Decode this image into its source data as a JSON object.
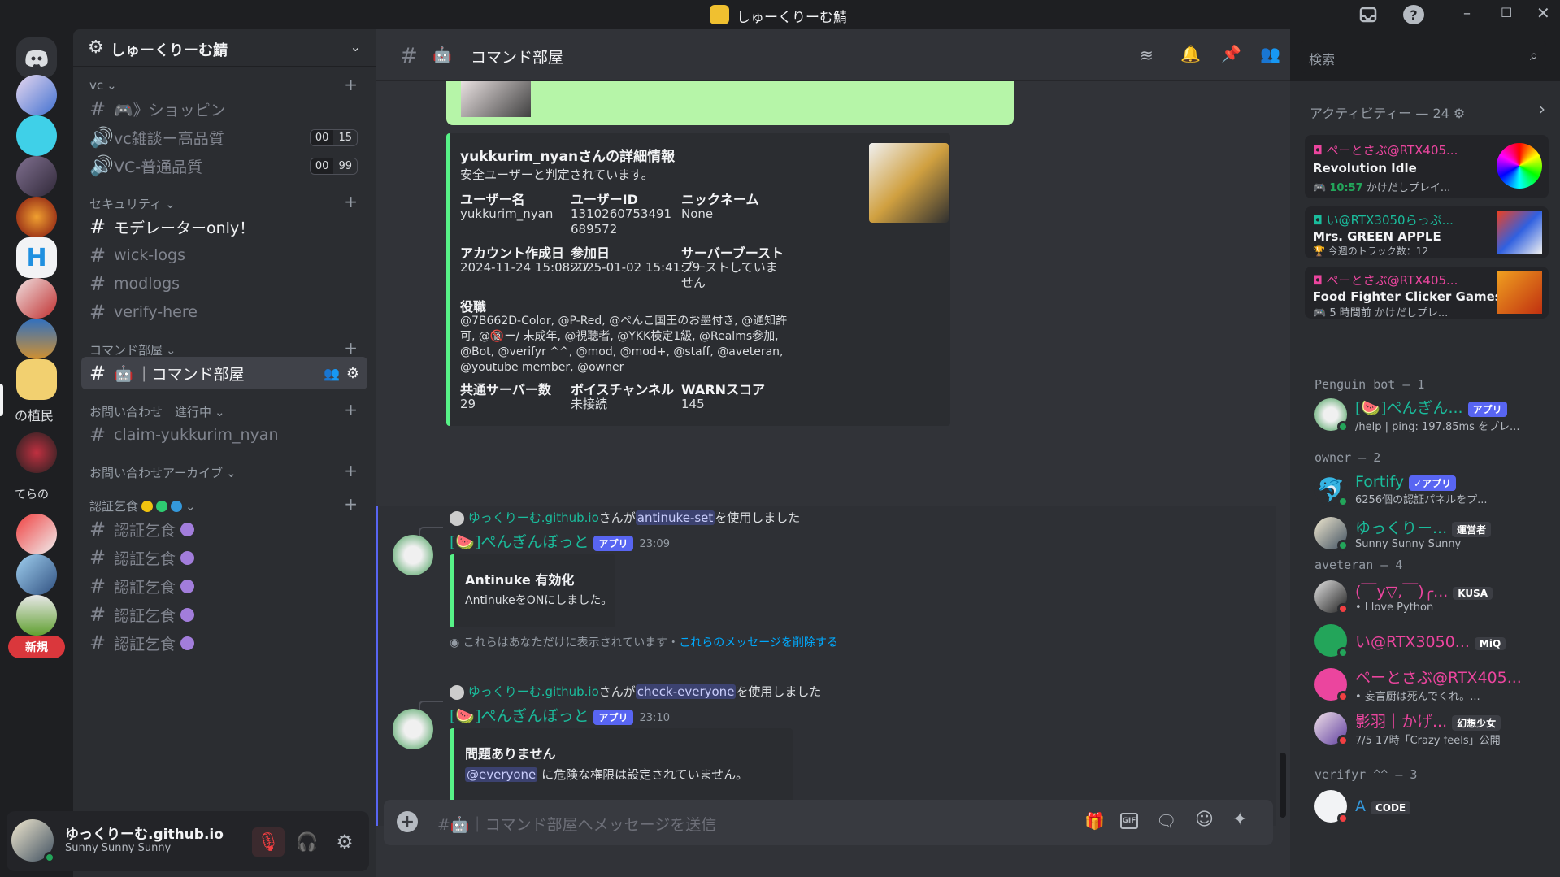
{
  "window": {
    "title": "しゅーくりーむ鯖"
  },
  "guilds": {
    "new_badge": "新規",
    "partial_labels": [
      "の植民",
      "てらの"
    ]
  },
  "server": {
    "name": "しゅーくりーむ鯖"
  },
  "categories": [
    {
      "label": "vc"
    },
    {
      "label": "セキュリティ"
    },
    {
      "label": "コマンド部屋"
    },
    {
      "label": "お問い合わせ　進行中"
    },
    {
      "label": "お問い合わせアーカイブ"
    },
    {
      "label": "認証乞食"
    }
  ],
  "channels": {
    "shopping": "🎮》ショッピン",
    "vc_high": "vc雑談ー高品質",
    "vc_high_counts": [
      "00",
      "15"
    ],
    "vc_normal": "VC-普通品質",
    "vc_normal_counts": [
      "00",
      "99"
    ],
    "moderator": "モデレーターonly！",
    "wick": "wick-logs",
    "modlogs": "modlogs",
    "verify": "verify-here",
    "command": "｜コマンド部屋",
    "claim": "claim-yukkurim_nyan",
    "auth": [
      "認証乞食",
      "認証乞食",
      "認証乞食",
      "認証乞食",
      "認証乞食"
    ]
  },
  "user": {
    "name": "ゆっくりーむ.github.io",
    "status": "Sunny Sunny Sunny"
  },
  "header": {
    "channel": "｜コマンド部屋",
    "search_placeholder": "検索"
  },
  "embed1": {
    "title": "yukkurim_nyanさんの詳細情報",
    "desc": "安全ユーザーと判定されています。",
    "f1_label": "ユーザー名",
    "f1_value": "yukkurim_nyan",
    "f2_label": "ユーザーID",
    "f2_value": "1310260753491689572",
    "f3_label": "ニックネーム",
    "f3_value": "None",
    "f4_label": "アカウント作成日",
    "f4_value": "2024-11-24 15:08:27",
    "f5_label": "参加日",
    "f5_value": "2025-01-02 15:41:29",
    "f6_label": "サーバーブースト",
    "f6_value": "ブーストしていません",
    "roles_label": "役職",
    "roles_value": "@7B662D-Color, @P-Red, @ぺんこ国王のお墨付き, @通知許可, @🔞ー/ 未成年, @視聴者, @YKK検定1級, @Realms参加, @Bot, @verifyr ^^, @mod, @mod+, @staff, @aveteran, @youtube member, @owner",
    "f7_label": "共通サーバー数",
    "f7_value": "29",
    "f8_label": "ボイスチャンネル",
    "f8_value": "未接続",
    "f9_label": "WARNスコア",
    "f9_value": "145"
  },
  "msg1": {
    "reply_user": "ゆっくりーむ.github.io",
    "reply_mid": "さんが",
    "reply_cmd": "antinuke-set",
    "reply_end": "を使用しました",
    "author": "[🍉]ぺんぎんぼっと",
    "app": "アプリ",
    "time": "23:09",
    "embed_title": "Antinuke 有効化",
    "embed_desc": "AntinukeをONにしました。",
    "ephemeral": "これらはあなただけに表示されています・",
    "dismiss": "これらのメッセージを削除する"
  },
  "msg2": {
    "reply_user": "ゆっくりーむ.github.io",
    "reply_mid": "さんが",
    "reply_cmd": "check-everyone",
    "reply_end": "を使用しました",
    "author": "[🍉]ぺんぎんぼっと",
    "app": "アプリ",
    "time": "23:10",
    "embed_title": "問題ありません",
    "embed_mention": "@everyone",
    "embed_desc": "に危険な権限は設定されていません。"
  },
  "composer": {
    "placeholder": "｜コマンド部屋へメッセージを送信"
  },
  "activity": {
    "header": "アクティビティー — 24",
    "items": [
      {
        "user": "ぺーとさぶ@RTX405...",
        "game": "Revolution Idle",
        "time": "10:57",
        "sub": "かけだしプレイ..."
      },
      {
        "user": "い@RTX3050らっぷ...",
        "game": "Mrs. GREEN APPLE",
        "sub": "今週のトラック数：12"
      },
      {
        "user": "ぺーとさぶ@RTX405...",
        "game": "Food Fighter Clicker Games",
        "time": "5 時間前",
        "sub": "かけだしプレ..."
      }
    ]
  },
  "groups": [
    {
      "title": "Penguin bot — 1"
    },
    {
      "title": "owner — 2"
    },
    {
      "title": "aveteran — 4"
    },
    {
      "title": "verifyr ^^ — 3"
    }
  ],
  "members": [
    {
      "name": "[🍉]ぺんぎん...",
      "badge": "アプリ",
      "sub": "/help | ping: 197.85ms をプレ..."
    },
    {
      "name": "Fortify",
      "badge": "✓アプリ",
      "sub": "6256個の認証パネルをプ..."
    },
    {
      "name": "ゆっくりー...",
      "badge": "運営者",
      "sub": "Sunny Sunny Sunny"
    },
    {
      "name": "(￣y▽,￣)╭...",
      "badge": "KUSA",
      "sub": "• I love Python"
    },
    {
      "name": "い@RTX3050...",
      "badge": "MiQ",
      "sub": ""
    },
    {
      "name": "ぺーとさぶ@RTX405...",
      "badge": "",
      "sub": "• 妄言厨は死んでくれ。..."
    },
    {
      "name": "影羽｜かげ...",
      "badge": "幻想少女",
      "sub": "7/5 17時「Crazy feels」公開"
    },
    {
      "name": "A",
      "badge": "CODE",
      "sub": ""
    }
  ],
  "colors": {
    "accent": "#5865f2",
    "green": "#57f287",
    "teal": "#1abc9c",
    "pink": "#eb459e",
    "bg": "#313338"
  }
}
